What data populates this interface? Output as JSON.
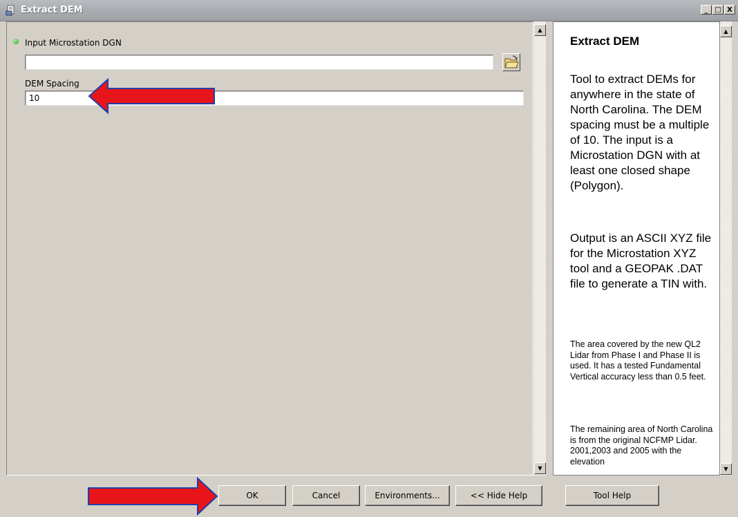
{
  "window": {
    "title": "Extract DEM",
    "minimize": "_",
    "maximize": "□",
    "close": "X"
  },
  "form": {
    "input_label": "Input Microstation DGN",
    "input_value": "",
    "spacing_label": "DEM Spacing",
    "spacing_value": "10"
  },
  "help": {
    "title": "Extract DEM",
    "para1": "Tool to extract DEMs for anywhere in the state of North Carolina. The DEM spacing must be a multiple of 10. The input is a Microstation DGN with at least one closed shape (Polygon).",
    "para2": "Output is an ASCII XYZ file for the Microstation XYZ tool and a GEOPAK .DAT file to generate a TIN with.",
    "para3": "The area covered by the new QL2 Lidar from Phase I and Phase II is used. It has a tested Fundamental Vertical accuracy less than 0.5 feet.",
    "para4": "The remaining area of North Carolina is from the original NCFMP Lidar. 2001,2003 and 2005 with the elevation"
  },
  "buttons": {
    "ok": "OK",
    "cancel": "Cancel",
    "environments": "Environments...",
    "hide_help": "<< Hide Help",
    "tool_help": "Tool Help"
  },
  "colors": {
    "arrow": "#e8151b",
    "arrow_outline": "#1f3fa8",
    "required_dot": "#2fa12a"
  }
}
